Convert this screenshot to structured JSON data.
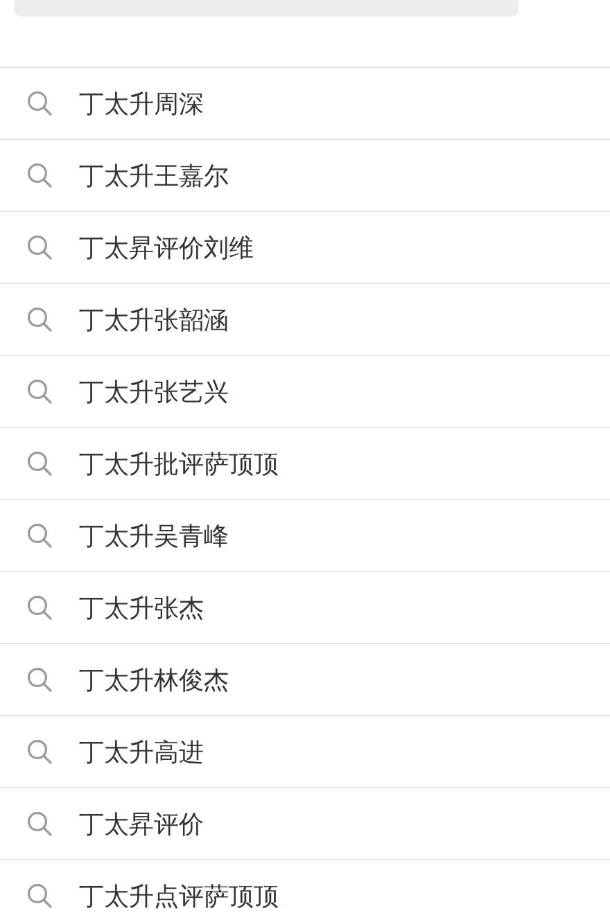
{
  "suggestions": [
    {
      "text": "丁太升周深"
    },
    {
      "text": "丁太升王嘉尔"
    },
    {
      "text": "丁太昇评价刘维"
    },
    {
      "text": "丁太升张韶涵"
    },
    {
      "text": "丁太升张艺兴"
    },
    {
      "text": "丁太升批评萨顶顶"
    },
    {
      "text": "丁太升吴青峰"
    },
    {
      "text": "丁太升张杰"
    },
    {
      "text": "丁太升林俊杰"
    },
    {
      "text": "丁太升高进"
    },
    {
      "text": "丁太昇评价"
    },
    {
      "text": "丁太升点评萨顶顶"
    }
  ]
}
